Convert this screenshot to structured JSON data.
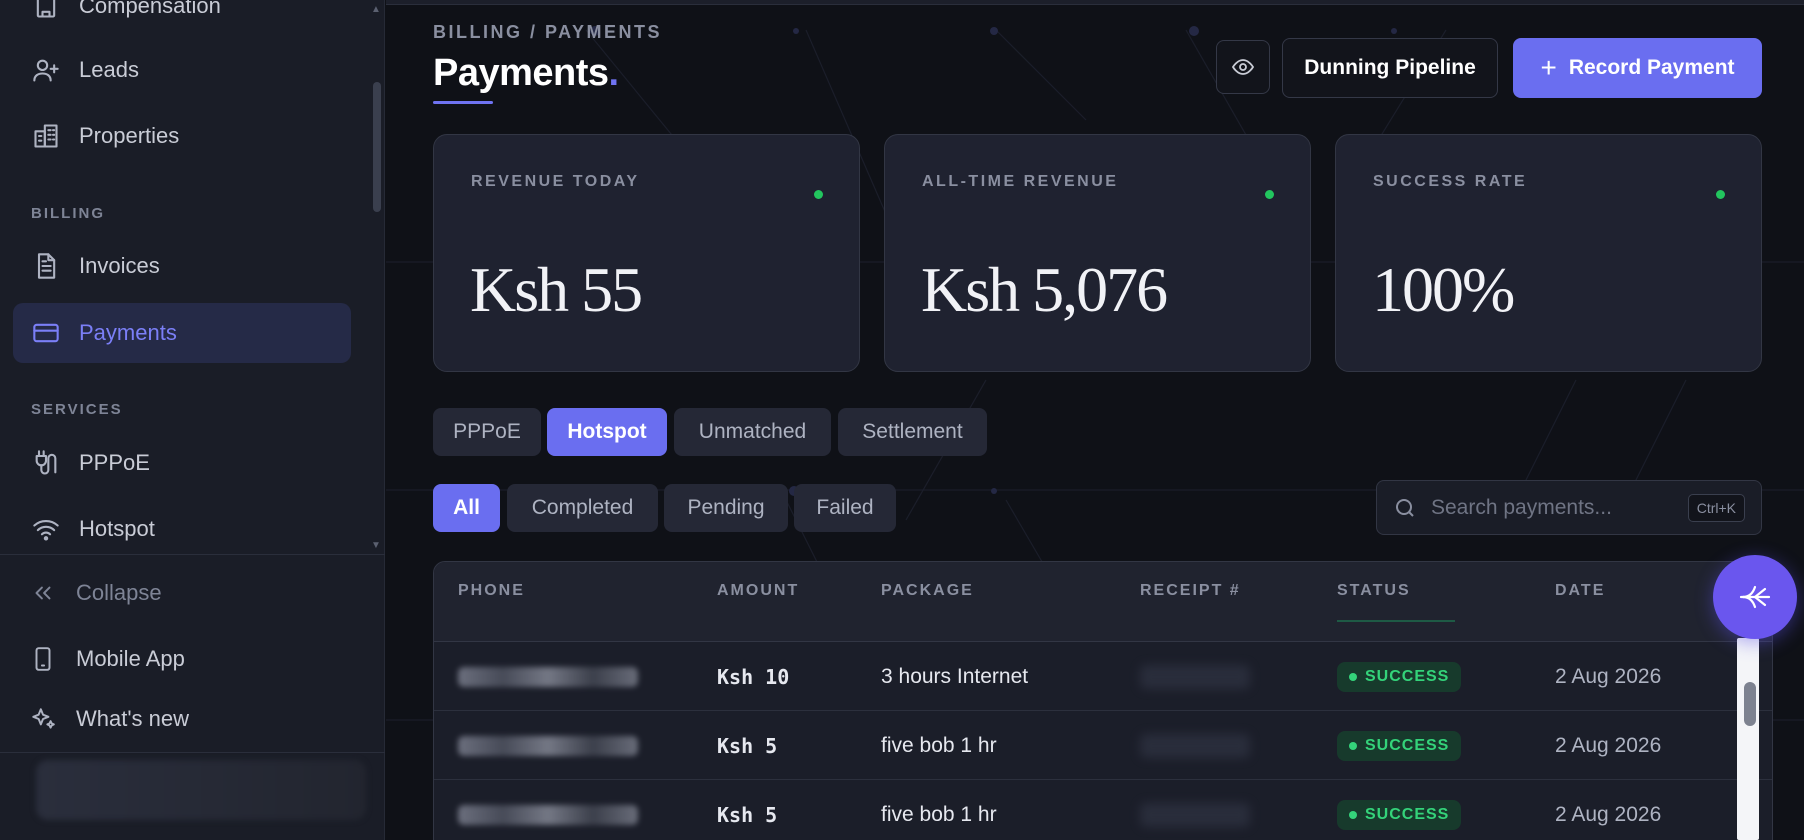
{
  "sidebar": {
    "items": [
      {
        "label": "Compensation",
        "icon": "building-icon"
      },
      {
        "label": "Leads",
        "icon": "user-plus-icon"
      },
      {
        "label": "Properties",
        "icon": "buildings-icon"
      },
      {
        "label": "Invoices",
        "icon": "document-icon"
      },
      {
        "label": "Payments",
        "icon": "credit-card-icon",
        "active": true
      },
      {
        "label": "PPPoE",
        "icon": "plug-icon"
      },
      {
        "label": "Hotspot",
        "icon": "wifi-icon"
      }
    ],
    "sections": {
      "billing": "BILLING",
      "services": "SERVICES"
    },
    "footer": {
      "collapse": "Collapse",
      "mobile_app": "Mobile App",
      "whats_new": "What's new"
    }
  },
  "header": {
    "breadcrumb": "BILLING / PAYMENTS",
    "title": "Payments.",
    "title_dot": ".",
    "dunning_label": "Dunning Pipeline",
    "record_label": "Record Payment",
    "record_plus": "+"
  },
  "stats": [
    {
      "label": "REVENUE TODAY",
      "value": "Ksh 55"
    },
    {
      "label": "ALL-TIME REVENUE",
      "value": "Ksh 5,076"
    },
    {
      "label": "SUCCESS RATE",
      "value": "100%"
    }
  ],
  "tabs": [
    "PPPoE",
    "Hotspot",
    "Unmatched",
    "Settlement"
  ],
  "active_tab": "Hotspot",
  "filters": [
    "All",
    "Completed",
    "Pending",
    "Failed"
  ],
  "active_filter": "All",
  "search": {
    "placeholder": "Search payments...",
    "value": "",
    "shortcut": "Ctrl+K"
  },
  "table": {
    "columns": [
      "PHONE",
      "AMOUNT",
      "PACKAGE",
      "RECEIPT #",
      "STATUS",
      "DATE"
    ],
    "rows": [
      {
        "amount": "Ksh 10",
        "package": "3 hours Internet",
        "status": "SUCCESS",
        "date": "2 Aug 2026"
      },
      {
        "amount": "Ksh 5",
        "package": "five bob 1 hr",
        "status": "SUCCESS",
        "date": "2 Aug 2026"
      },
      {
        "amount": "Ksh 5",
        "package": "five bob 1 hr",
        "status": "SUCCESS",
        "date": "2 Aug 2026"
      }
    ]
  },
  "colors": {
    "accent": "#6a6ef0",
    "success": "#34d37a",
    "background": "#0f1117",
    "card": "#1f2230"
  }
}
